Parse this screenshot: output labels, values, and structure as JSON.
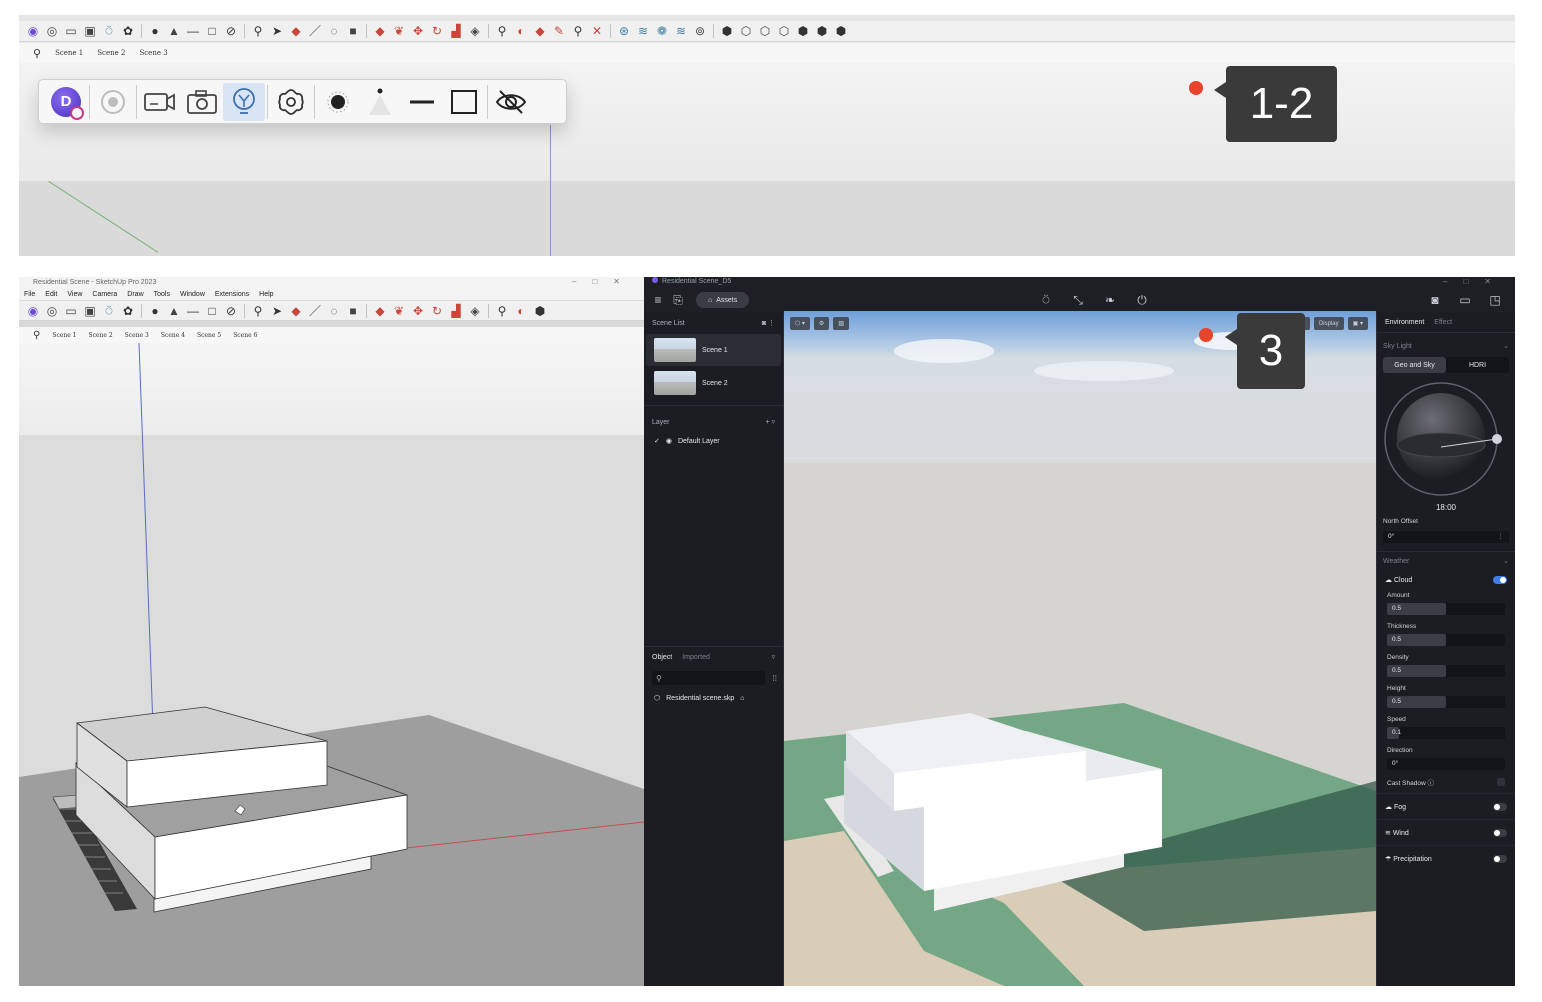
{
  "top": {
    "scene_tabs": [
      "Scene 1",
      "Scene 2",
      "Scene 3"
    ],
    "callout": "1-2"
  },
  "left": {
    "window_title": "Residential Scene - SketchUp Pro 2023",
    "menu": [
      "File",
      "Edit",
      "View",
      "Camera",
      "Draw",
      "Tools",
      "Window",
      "Extensions",
      "Help"
    ],
    "scene_tabs": [
      "Scene 1",
      "Scene 2",
      "Scene 3",
      "Scene 4",
      "Scene 5",
      "Scene 6"
    ]
  },
  "right": {
    "window_title": "Residential Scene_D5",
    "assets_label": "Assets",
    "scene_list_title": "Scene List",
    "scenes": [
      "Scene 1",
      "Scene 2"
    ],
    "layer_title": "Layer",
    "default_layer": "Default Layer",
    "object_tabs": [
      "Object",
      "Imported"
    ],
    "object_item": "Residential scene.skp",
    "viewport_chips": [
      "Camera",
      "Display"
    ],
    "callout": "3",
    "env_tabs": [
      "Environment",
      "Effect"
    ],
    "sky_light_title": "Sky Light",
    "sky_modes": [
      "Geo and Sky",
      "HDRI"
    ],
    "time": "18:00",
    "north_offset_label": "North Offset",
    "north_offset_value": "0°",
    "weather_title": "Weather",
    "cloud_label": "Cloud",
    "fields": [
      {
        "label": "Amount",
        "value": "0.5",
        "fill": 0.5
      },
      {
        "label": "Thickness",
        "value": "0.5",
        "fill": 0.5
      },
      {
        "label": "Density",
        "value": "0.5",
        "fill": 0.5
      },
      {
        "label": "Height",
        "value": "0.5",
        "fill": 0.5
      },
      {
        "label": "Speed",
        "value": "0.1",
        "fill": 0.1
      },
      {
        "label": "Direction",
        "value": "0°",
        "fill": 0
      }
    ],
    "cast_shadow_label": "Cast Shadow",
    "toggles": [
      "Fog",
      "Wind",
      "Precipitation"
    ]
  },
  "colors": {
    "accent_red": "#e8432d",
    "callout_bg": "#3a3a3a",
    "d5_bg": "#1d1f24",
    "toggle_on": "#3f7cf2",
    "ground_green": "#6fa07d"
  }
}
